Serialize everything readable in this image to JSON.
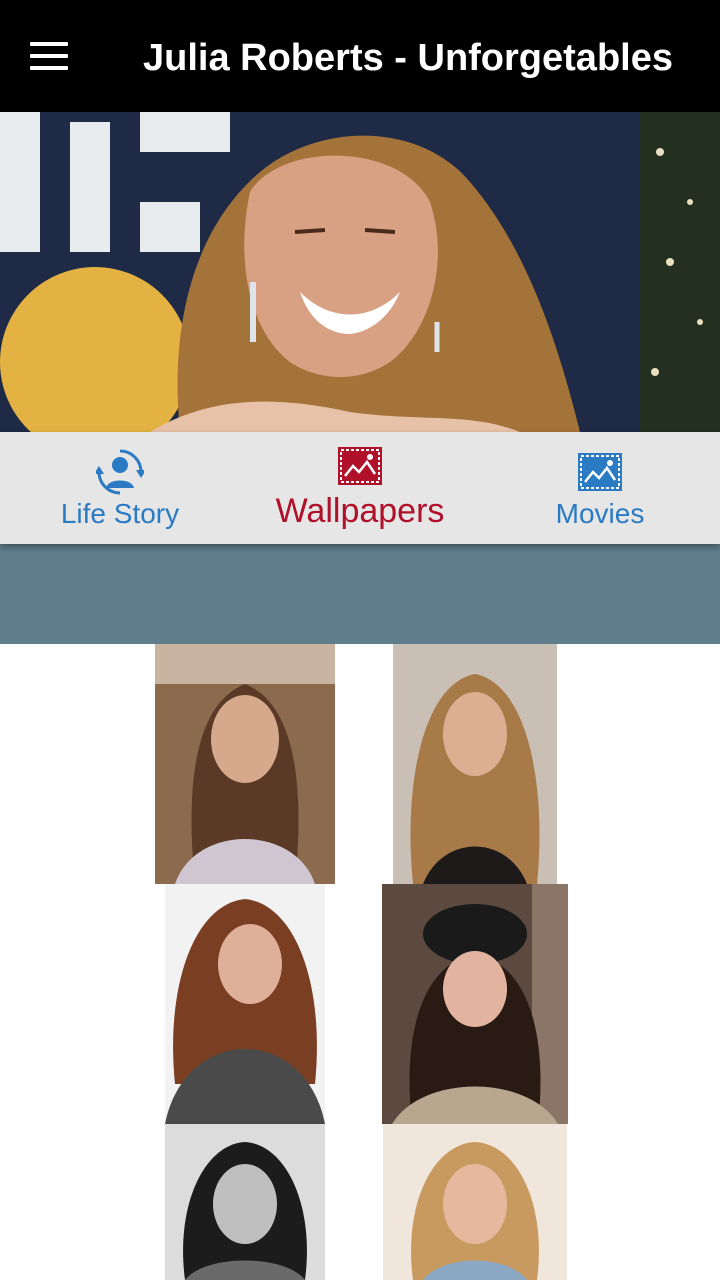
{
  "app_bar": {
    "title": "Julia Roberts - Unforgetables",
    "menu_icon": "hamburger-menu-icon"
  },
  "hero": {
    "subject": "portrait"
  },
  "tabs": [
    {
      "label": "Life Story",
      "icon": "user-sync-icon",
      "color": "#2a7ac4",
      "selected": false
    },
    {
      "label": "Wallpapers",
      "icon": "image-icon",
      "color": "#b0102a",
      "selected": true
    },
    {
      "label": "Movies",
      "icon": "image-icon",
      "color": "#2a7ac4",
      "selected": false
    }
  ],
  "colors": {
    "app_bar": "#000000",
    "tab_bar": "#e6e6e6",
    "banner": "#607d8b",
    "selected_tab": "#b0102a",
    "unselected_tab": "#2a7ac4"
  },
  "gallery": {
    "item_count": 6
  }
}
